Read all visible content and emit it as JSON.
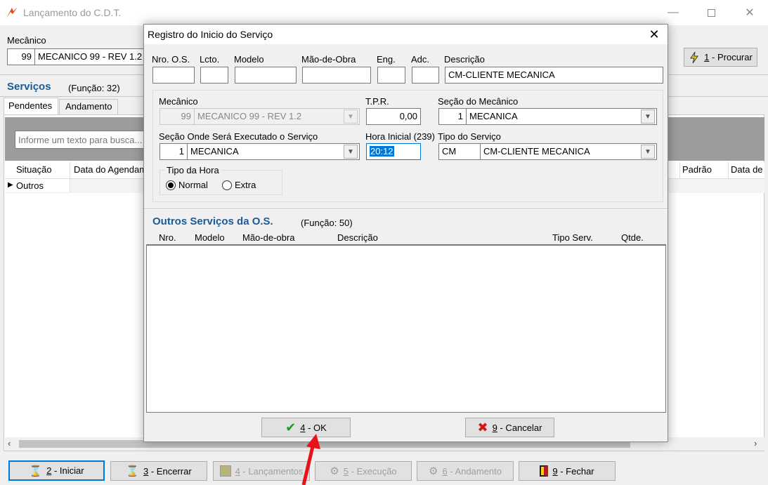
{
  "main": {
    "title": "Lançamento do C.D.T.",
    "mecanico_label": "Mecânico",
    "mecanico_code": "99",
    "mecanico_name": "MECANICO 99 - REV 1.2",
    "procurar": {
      "key": "1",
      "label": " - Procurar"
    },
    "servicos_title": "Serviços",
    "servicos_funcao": "(Função: 32)",
    "tabs": [
      {
        "label": "Pendentes"
      },
      {
        "label": "Andamento"
      }
    ],
    "search_placeholder": "Informe um texto para busca...",
    "columns": {
      "situacao": "Situação",
      "data_agendamento": "Data do Agendam",
      "padrao": "Padrão",
      "data_de": "Data de"
    },
    "row": {
      "situacao": "Outros"
    },
    "buttons": [
      {
        "key": "2",
        "label": " - Iniciar"
      },
      {
        "key": "3",
        "label": " - Encerrar"
      },
      {
        "key": "4",
        "label": " - Lançamentos"
      },
      {
        "key": "5",
        "label": " - Execução"
      },
      {
        "key": "6",
        "label": " - Andamento"
      },
      {
        "key": "9",
        "label": " - Fechar"
      }
    ]
  },
  "dialog": {
    "title": "Registro do Inicio do Serviço",
    "labels": {
      "nro_os": "Nro. O.S.",
      "lcto": "Lcto.",
      "modelo": "Modelo",
      "mao_obra": "Mão-de-Obra",
      "eng": "Eng.",
      "adc": "Adc.",
      "descricao": "Descrição",
      "mecanico": "Mecânico",
      "tpr": "T.P.R.",
      "secao_mecanico": "Seção do Mecânico",
      "secao_executado": "Seção Onde Será Executado o Serviço",
      "hora_inicial": "Hora Inicial (239)",
      "tipo_servico": "Tipo do Serviço",
      "tipo_hora": "Tipo da Hora"
    },
    "values": {
      "descricao": "CM-CLIENTE MECANICA",
      "mecanico_code": "99",
      "mecanico_name": "MECANICO 99 - REV 1.2",
      "tpr": "0,00",
      "secao_mecanico_code": "1",
      "secao_mecanico_name": "MECANICA",
      "secao_exec_code": "1",
      "secao_exec_name": "MECANICA",
      "hora_inicial": "20:12",
      "tipo_servico_code": "CM",
      "tipo_servico_name": "CM-CLIENTE MECANICA"
    },
    "radio": {
      "normal": "Normal",
      "extra": "Extra"
    },
    "outros_title": "Outros Serviços da O.S.",
    "outros_funcao": "(Função: 50)",
    "outros_columns": {
      "nro": "Nro.",
      "modelo": "Modelo",
      "mao_obra": "Mão-de-obra",
      "descricao": "Descrição",
      "tipo_serv": "Tipo Serv.",
      "qtde": "Qtde."
    },
    "ok": {
      "key": "4",
      "label": " - OK"
    },
    "cancel": {
      "key": "9",
      "label": " - Cancelar"
    }
  },
  "colors": {
    "accent": "#1a5a96",
    "focus": "#0078d7",
    "arrow": "#e8121b"
  }
}
